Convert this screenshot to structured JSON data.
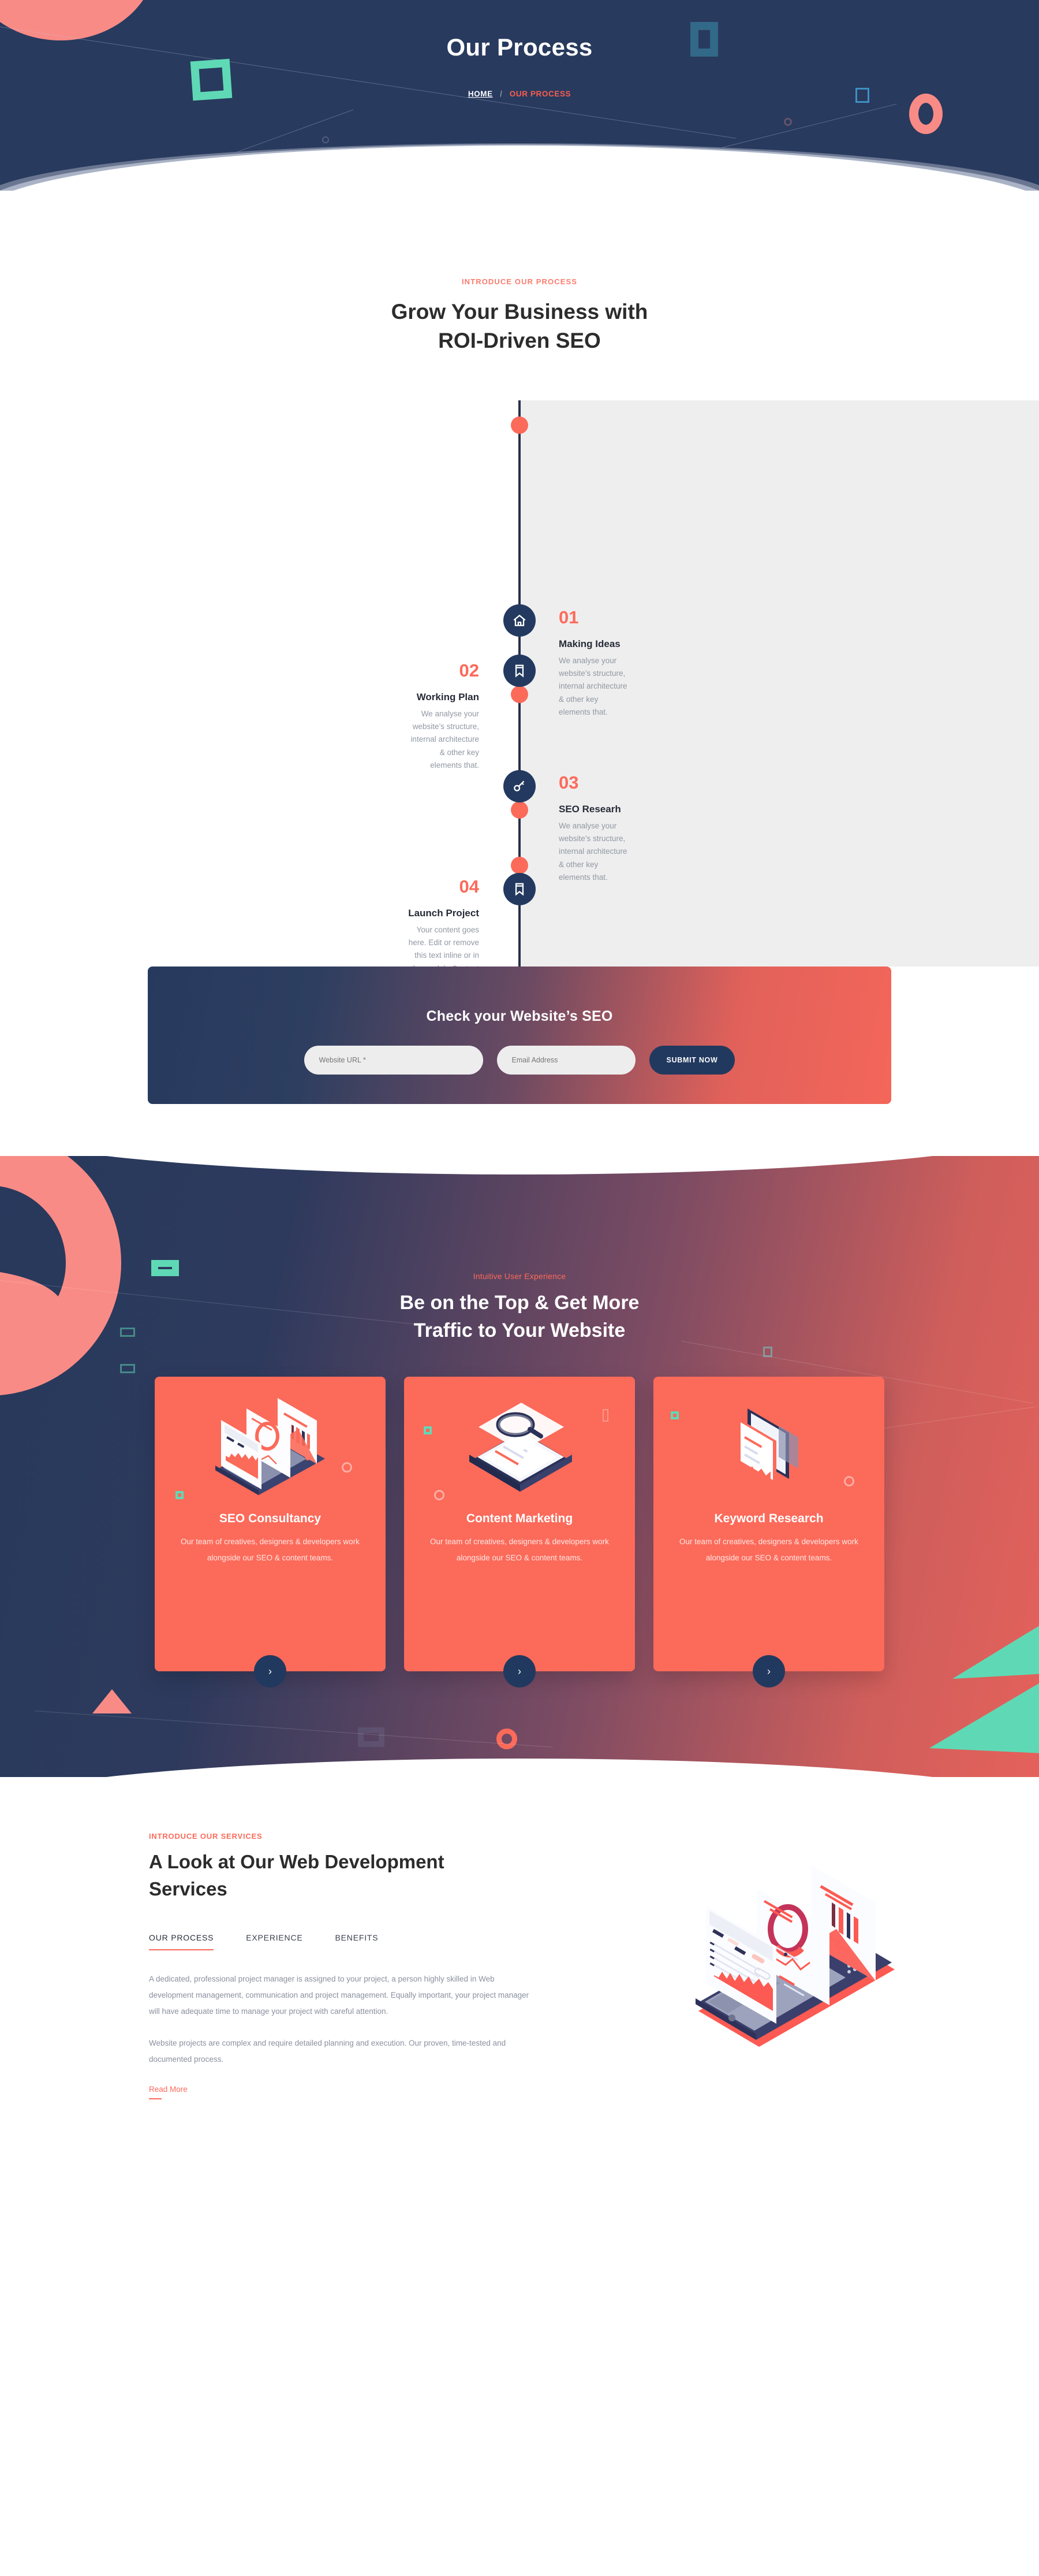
{
  "hero": {
    "title": "Our Process",
    "breadcrumb": {
      "home": "HOME",
      "separator": "/",
      "current": "OUR PROCESS"
    },
    "colors": {
      "bg": "#283a5e",
      "accent": "#fc5d4e",
      "mint": "#5fd9b5",
      "salmon": "#f98b86"
    }
  },
  "intro": {
    "eyebrow": "INTRODUCE OUR PROCESS",
    "heading_line1": "Grow Your Business with",
    "heading_line2": "ROI-Driven SEO"
  },
  "timeline": {
    "steps": [
      {
        "number": "01",
        "title": "Making Ideas",
        "description": "We analyse your website’s structure, internal architecture & other key elements that.",
        "icon": "home-icon",
        "side": "right"
      },
      {
        "number": "02",
        "title": "Working Plan",
        "description": "We analyse your website’s structure, internal architecture & other key elements that.",
        "icon": "bookmark-icon",
        "side": "left"
      },
      {
        "number": "03",
        "title": "SEO Researh",
        "description": "We analyse your website’s structure, internal architecture & other key elements that.",
        "icon": "key-icon",
        "side": "right"
      },
      {
        "number": "04",
        "title": "Launch Project",
        "description": "Your content goes here. Edit or remove this text inline or in the module Content settings.",
        "icon": "bookmark-icon",
        "side": "left"
      }
    ]
  },
  "seo_check": {
    "heading": "Check your Website’s SEO",
    "url_placeholder": "Website URL *",
    "email_placeholder": "Email Address",
    "url_value": "",
    "email_value": "",
    "submit_label": "SUBMIT NOW"
  },
  "services_banner": {
    "eyebrow": "Intuitive User Experience",
    "heading_line1": "Be on the Top & Get More",
    "heading_line2": "Traffic to Your Website",
    "cards": [
      {
        "title": "SEO Consultancy",
        "description": "Our team of creatives, designers & developers work alongside our SEO & content teams.",
        "illustration": "dashboard-tablet-illustration",
        "arrow_label": "›"
      },
      {
        "title": "Content Marketing",
        "description": "Our team of creatives, designers & developers work alongside our SEO & content teams.",
        "illustration": "document-magnifier-illustration",
        "arrow_label": "›"
      },
      {
        "title": "Keyword Research",
        "description": "Our team of creatives, designers & developers work alongside our SEO & content teams.",
        "illustration": "phone-screens-illustration",
        "arrow_label": "›"
      }
    ]
  },
  "about": {
    "eyebrow": "INTRODUCE OUR SERVICES",
    "heading_line1": "A Look at Our Web Development",
    "heading_line2": "Services",
    "tabs": [
      {
        "label": "OUR PROCESS",
        "active": true
      },
      {
        "label": "EXPERIENCE",
        "active": false
      },
      {
        "label": "BENEFITS",
        "active": false
      }
    ],
    "paragraph1": "A dedicated, professional project manager is assigned to your project, a person highly skilled in Web development management, communication and project management. Equally important, your project manager will have adequate time to manage your project with careful attention.",
    "paragraph2": "Website projects are complex and require detailed planning and execution. Our proven, time-tested and documented process.",
    "read_more": "Read More",
    "illustration": "mobile-analytics-illustration"
  }
}
